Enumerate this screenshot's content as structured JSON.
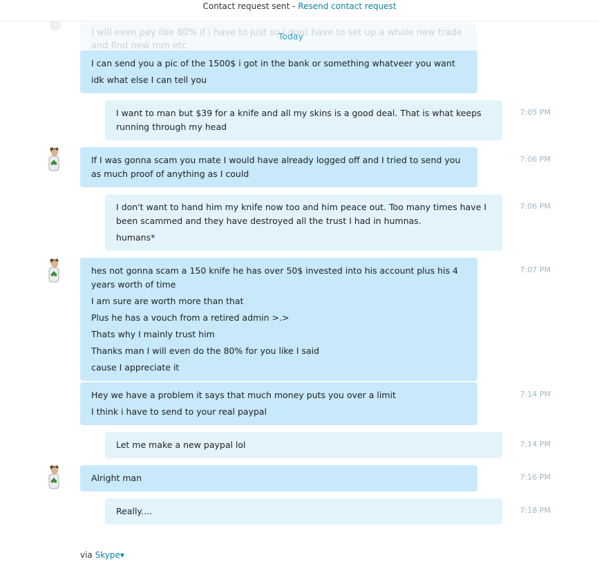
{
  "top_banner": {
    "status": "Contact request sent",
    "separator": " - ",
    "action": "Resend contact request"
  },
  "faded_message": "I will even pay like 80% if i have to just so i dont have to set up a whole new trade and find new mm etc",
  "day_label": "Today",
  "messages": [
    {
      "from": "them",
      "lines": [
        "I can send you a pic of the 1500$ i got in the bank or something whatveer you want",
        "idk what else I can tell you"
      ],
      "time": ""
    },
    {
      "from": "me",
      "lines": [
        "I want to man but $39 for a knife and all my skins is a good deal. That is what keeps running through my head"
      ],
      "time": "7:05 PM"
    },
    {
      "from": "them",
      "lines": [
        "If I was gonna scam you mate I would have already logged off and I tried to send you as much proof of anything as I could"
      ],
      "time": "7:06 PM"
    },
    {
      "from": "me",
      "lines": [
        "I don't want to hand him my knife now too and him peace out. Too many times have I been scammed and they have destroyed all the trust I had in humnas.",
        "humans*"
      ],
      "time": "7:06 PM"
    },
    {
      "from": "them",
      "lines": [
        "hes not gonna scam a 150 knife he has over 50$ invested into his account plus his 4 years worth of time",
        "I am sure are worth more than that",
        "Plus he has a vouch from a retired admin >.>",
        "Thats why I mainly trust him",
        "Thanks man I will even do the 80% for you like I said",
        "cause I appreciate it"
      ],
      "time": "7:07 PM"
    },
    {
      "from": "them",
      "lines": [
        "Hey we have a problem it says that much money puts you over a limit",
        "I think i have to send to your real paypal"
      ],
      "time": "7:14 PM"
    },
    {
      "from": "me",
      "lines": [
        "Let me make a new paypal lol"
      ],
      "time": "7:14 PM"
    },
    {
      "from": "them",
      "lines": [
        "Alright man"
      ],
      "time": "7:16 PM"
    },
    {
      "from": "me",
      "lines": [
        "Really...."
      ],
      "time": "7:18 PM"
    }
  ],
  "footer": {
    "via": "via",
    "brand": "Skype",
    "caret": "▾"
  },
  "colors": {
    "them_bubble": "#c7e9fa",
    "me_bubble": "#e3f3fb",
    "link": "#0b83a6",
    "timestamp": "#9eb8c6"
  },
  "icons": {
    "avatar": "user-avatar-icon",
    "dropdown": "chevron-down-icon"
  }
}
